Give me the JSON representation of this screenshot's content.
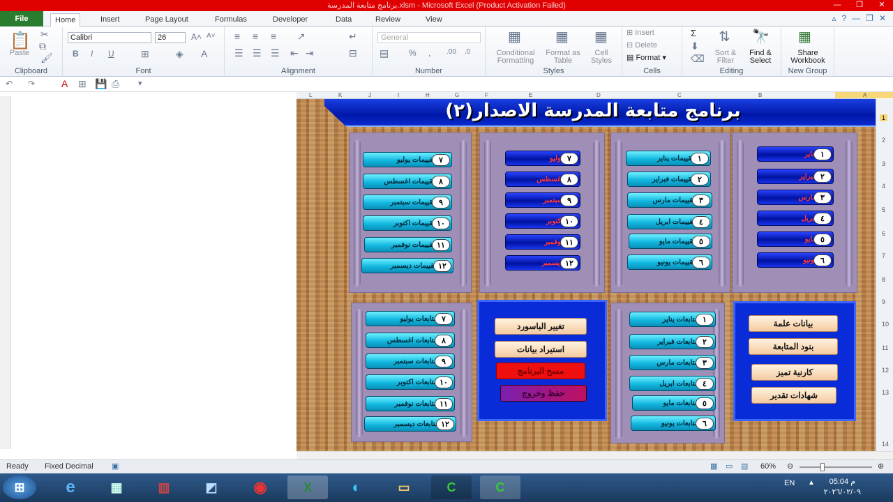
{
  "window": {
    "title": "برنامج متابعة المدرسة.xlsm - Microsoft Excel (Product Activation Failed)"
  },
  "tabs": {
    "file": "File",
    "home": "Home",
    "insert": "Insert",
    "page_layout": "Page Layout",
    "formulas": "Formulas",
    "developer": "Developer",
    "data": "Data",
    "review": "Review",
    "view": "View"
  },
  "ribbon": {
    "clipboard": {
      "paste": "Paste",
      "name": "Clipboard"
    },
    "font": {
      "family": "Calibri",
      "size": "26",
      "bold": "B",
      "italic": "I",
      "underline": "U",
      "name": "Font"
    },
    "alignment": {
      "name": "Alignment"
    },
    "number": {
      "format": "General",
      "percent": "%",
      "comma": ",",
      "name": "Number"
    },
    "styles": {
      "conditional": "Conditional Formatting",
      "format_table": "Format as Table",
      "cell_styles": "Cell Styles",
      "name": "Styles"
    },
    "cells": {
      "insert": "Insert",
      "delete": "Delete",
      "format": "Format",
      "name": "Cells"
    },
    "editing": {
      "sigma": "Σ",
      "sort": "Sort & Filter",
      "find": "Find & Select",
      "name": "Editing"
    },
    "share": {
      "label": "Share Workbook",
      "name": "New Group"
    }
  },
  "columns": [
    "L",
    "K",
    "J",
    "I",
    "H",
    "G",
    "F",
    "E",
    "D",
    "C",
    "B",
    "A"
  ],
  "rows": [
    "1",
    "2",
    "3",
    "4",
    "5",
    "6",
    "7",
    "8",
    "9",
    "10",
    "11",
    "12",
    "13",
    "14"
  ],
  "sheet": {
    "banner": "برنامج   متابعة  المدرسة  الاصدار(٢)",
    "months_panel": [
      {
        "num": "١",
        "label": "يناير"
      },
      {
        "num": "٢",
        "label": "فبراير"
      },
      {
        "num": "٣",
        "label": "مارس"
      },
      {
        "num": "٤",
        "label": "ابريل"
      },
      {
        "num": "٥",
        "label": "مايو"
      },
      {
        "num": "٦",
        "label": "يونيو"
      }
    ],
    "evals_panel_1": [
      {
        "num": "١",
        "label": "تقييمات يناير"
      },
      {
        "num": "٢",
        "label": "تقييمات فبراير"
      },
      {
        "num": "٣",
        "label": "تقييمات مارس"
      },
      {
        "num": "٤",
        "label": "تقييمات ابريل"
      },
      {
        "num": "٥",
        "label": "تقييمات مايو"
      },
      {
        "num": "٦",
        "label": "تقييمات يونيو"
      }
    ],
    "months_panel_2": [
      {
        "num": "٧",
        "label": "يوليو"
      },
      {
        "num": "٨",
        "label": "اغسطس"
      },
      {
        "num": "٩",
        "label": "سبتمبر"
      },
      {
        "num": "١٠",
        "label": "اكتوبر"
      },
      {
        "num": "١١",
        "label": "نوفمبر"
      },
      {
        "num": "١٢",
        "label": "ديسمبر"
      }
    ],
    "evals_panel_2": [
      {
        "num": "٧",
        "label": "تقييمات يوليو"
      },
      {
        "num": "٨",
        "label": "تقييمات اغسطس"
      },
      {
        "num": "٩",
        "label": "تقييمات سبتمبر"
      },
      {
        "num": "١٠",
        "label": "تقييمات اكتوبر"
      },
      {
        "num": "١١",
        "label": "تقييمات نوفمبر"
      },
      {
        "num": "١٢",
        "label": "تقييمات ديسمبر"
      }
    ],
    "followups_1": [
      {
        "num": "١",
        "label": "متابعات يناير"
      },
      {
        "num": "٢",
        "label": "متابعات فبراير"
      },
      {
        "num": "٣",
        "label": "متابعات مارس"
      },
      {
        "num": "٤",
        "label": "متابعات ابريل"
      },
      {
        "num": "٥",
        "label": "متابعات مايو"
      },
      {
        "num": "٦",
        "label": "متابعات يونيو"
      }
    ],
    "followups_2": [
      {
        "num": "٧",
        "label": "متابعات يوليو"
      },
      {
        "num": "٨",
        "label": "متابعات اغسطس"
      },
      {
        "num": "٩",
        "label": "متابعات سبتمبر"
      },
      {
        "num": "١٠",
        "label": "متابعات اكتوبر"
      },
      {
        "num": "١١",
        "label": "متابعات نوفمبر"
      },
      {
        "num": "١٢",
        "label": "متابعات ديسمبر"
      }
    ],
    "general_box": [
      "بيانات علمة",
      "بنود المتابعة",
      "كارنية تميز",
      "شهادات تقدير"
    ],
    "control_box": [
      "تغيير الباسورد",
      "استيراد بيانات",
      "مسح البرنامج",
      "حفظ وخروج"
    ]
  },
  "status": {
    "ready": "Ready",
    "mode": "Fixed Decimal",
    "zoom": "60%"
  },
  "taskbar": {
    "lang": "EN",
    "time": "05:04 م",
    "date": "٢٠٢٦/٠٢/٠٩"
  }
}
